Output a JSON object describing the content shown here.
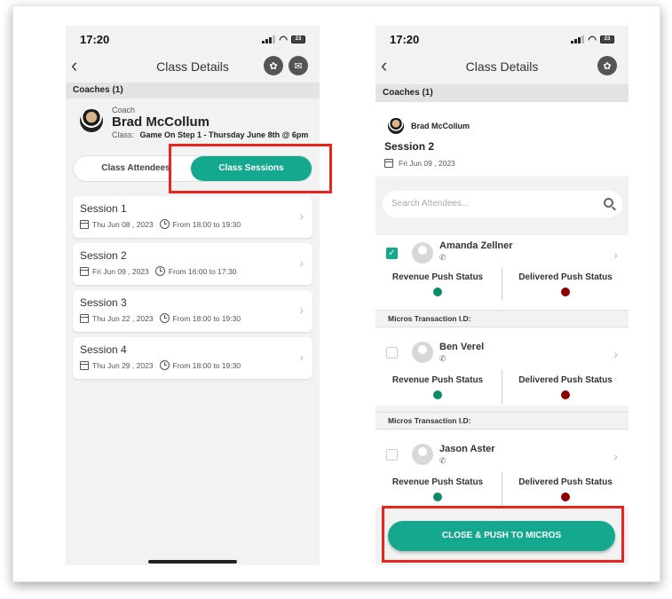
{
  "left": {
    "time": "17:20",
    "battery": "23",
    "nav_title": "Class Details",
    "coaches_label": "Coaches (1)",
    "coach_role": "Coach",
    "coach_name": "Brad McCollum",
    "class_label": "Class:",
    "class_value": "Game On Step 1 - Thursday June 8th @ 6pm",
    "tab_attendees": "Class Attendees",
    "tab_sessions": "Class Sessions",
    "sessions": [
      {
        "name": "Session 1",
        "date": "Thu Jun 08 , 2023",
        "time": "From 18:00 to 19:30"
      },
      {
        "name": "Session 2",
        "date": "Fri Jun 09 , 2023",
        "time": "From 16:00 to 17:30"
      },
      {
        "name": "Session 3",
        "date": "Thu Jun 22 , 2023",
        "time": "From 18:00 to 19:30"
      },
      {
        "name": "Session 4",
        "date": "Thu Jun 29 , 2023",
        "time": "From 18:00 to 19:30"
      }
    ]
  },
  "right": {
    "time": "17:20",
    "battery": "23",
    "nav_title": "Class Details",
    "coaches_label": "Coaches (1)",
    "coach_name": "Brad McCollum",
    "session_title": "Session 2",
    "session_date": "Fri Jun 09 , 2023",
    "search_placeholder": "Search Attendees...",
    "revenue_label": "Revenue Push Status",
    "delivered_label": "Delivered Push Status",
    "micros_label": "Micros Transaction I.D:",
    "attendees": [
      {
        "name": "Amanda Zellner",
        "checked": true
      },
      {
        "name": "Ben Verel",
        "checked": false
      },
      {
        "name": "Jason Aster",
        "checked": false
      }
    ],
    "push_button": "CLOSE & PUSH TO MICROS"
  },
  "colors": {
    "accent": "#14a88e",
    "revenue_dot": "#0e8a6a",
    "delivered_dot": "#8b0000",
    "highlight_box": "#e8261e"
  }
}
